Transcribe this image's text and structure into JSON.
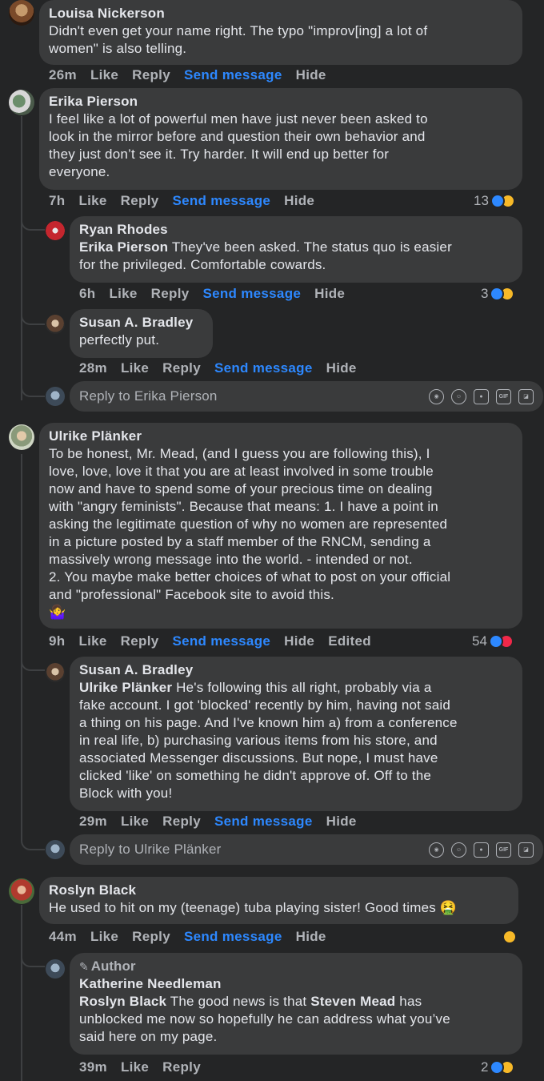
{
  "comments": [
    {
      "name": "Louisa Nickerson",
      "text": "Didn't even get your name right. The typo \"improv[ing] a lot of\nwomen\" is also telling.",
      "time": "26m",
      "like": "Like",
      "reply": "Reply",
      "send": "Send message",
      "hide": "Hide"
    },
    {
      "name": "Erika Pierson",
      "text": "I feel like a lot of powerful men have just never been asked to\nlook in the mirror before and question their own behavior and\nthey just don’t see it. Try harder. It will end up better for\neveryone.",
      "time": "7h",
      "like": "Like",
      "reply": "Reply",
      "send": "Send message",
      "hide": "Hide",
      "reactions": "13"
    },
    {
      "name": "Ryan Rhodes",
      "tag": "Erika Pierson",
      "text": " They've been asked. The status quo is easier\nfor the privileged. Comfortable cowards.",
      "time": "6h",
      "like": "Like",
      "reply": "Reply",
      "send": "Send message",
      "hide": "Hide",
      "reactions": "3"
    },
    {
      "name": "Susan A. Bradley",
      "text": "perfectly put.",
      "time": "28m",
      "like": "Like",
      "reply": "Reply",
      "send": "Send message",
      "hide": "Hide"
    },
    {
      "name": "Ulrike Plänker",
      "text": "To be honest, Mr. Mead, (and I guess you are following this), I\nlove, love, love it that you are at least involved in some trouble\nnow and have to spend some of your precious time on dealing\nwith \"angry feminists\". Because that means: 1. I have a point in\nasking the legitimate question of why no women are represented\nin a picture posted by a staff member of the RNCM, sending a\nmassively wrong message into the world. - intended or not.\n2. You maybe make better choices of what to post on your official\nand \"professional\" Facebook site to avoid this.\n🤷‍♀️",
      "time": "9h",
      "like": "Like",
      "reply": "Reply",
      "send": "Send message",
      "hide": "Hide",
      "edited": "Edited",
      "reactions": "54"
    },
    {
      "name": "Susan A. Bradley",
      "tag": "Ulrike Plänker",
      "text": " He's following this all right, probably via a\nfake account. I got 'blocked' recently by him, having not said\na thing on his page. And I've known him a) from a conference\nin real life, b) purchasing various items from his store, and\nassociated Messenger discussions. But nope, I must have\nclicked 'like' on something he didn't approve of. Off to the\nBlock with you!",
      "time": "29m",
      "like": "Like",
      "reply": "Reply",
      "send": "Send message",
      "hide": "Hide"
    },
    {
      "name": "Roslyn Black",
      "text": "He used to hit on my (teenage) tuba playing sister! Good times 🤮",
      "time": "44m",
      "like": "Like",
      "reply": "Reply",
      "send": "Send message",
      "hide": "Hide"
    },
    {
      "author_label": "Author",
      "name": "Katherine Needleman",
      "tag": "Roslyn Black",
      "text_a": " The good news is that ",
      "tag2": "Steven Mead",
      "text_b": " has\nunblocked me now so hopefully he can address what you’ve\nsaid here on my page.",
      "time": "39m",
      "like": "Like",
      "reply": "Reply",
      "reactions": "2"
    }
  ],
  "reply_boxes": [
    {
      "placeholder": "Reply to Erika Pierson"
    },
    {
      "placeholder": "Reply to Ulrike Plänker"
    }
  ],
  "tool_icons": [
    "sticker-face-icon",
    "emoji-icon",
    "camera-icon",
    "gif-icon",
    "sticker-icon"
  ],
  "gif_label": "GIF",
  "colors": {
    "background": "#242526",
    "bubble": "#3a3b3c",
    "link": "#2d88ff",
    "muted": "#b0b3b8",
    "text": "#e4e6eb"
  }
}
